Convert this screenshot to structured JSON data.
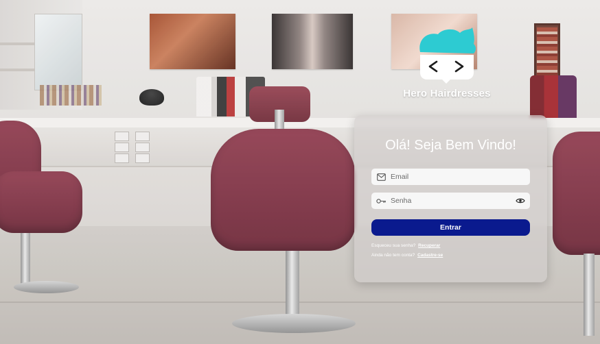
{
  "brand": {
    "name": "Hero Hairdresses",
    "logo_icon": "hero-hair-code-icon",
    "logo_symbols": "< >",
    "colors": {
      "hair": "#2dcbd2",
      "mask": "#ffffff",
      "ink": "#1d1d1d"
    }
  },
  "login": {
    "title": "Olá! Seja Bem Vindo!",
    "email": {
      "placeholder": "Email",
      "value": "",
      "icon": "mail-icon"
    },
    "password": {
      "placeholder": "Senha",
      "value": "",
      "icon": "key-icon",
      "toggle_icon": "eye-icon"
    },
    "submit_label": "Entrar",
    "forgot_text": "Esqueceu sua senha?",
    "forgot_link": "Recuperar",
    "signup_text": "Ainda não tem conta?",
    "signup_link": "Cadastre-se"
  },
  "theme": {
    "button_color": "#0a1a8e",
    "card_color": "rgba(210,205,204,0.66)",
    "text_color": "#ffffff"
  },
  "background": {
    "icon": "salon-photo"
  }
}
